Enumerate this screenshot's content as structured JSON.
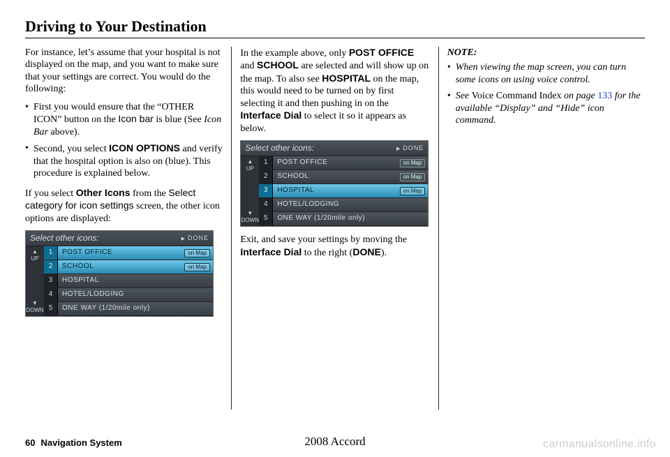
{
  "page": {
    "title": "Driving to Your Destination",
    "number": "60",
    "system_label": "Navigation System",
    "model": "2008  Accord",
    "watermark": "carmanualsonline.info"
  },
  "col1": {
    "p1": "For instance, let’s assume that your hospital is not displayed on the map, and you want to make sure that your settings are correct. You would do the following:",
    "b1_pre": "First you would ensure that the “OTHER ICON” button on the ",
    "b1_icon_bar": "Icon bar",
    "b1_mid": " is blue (See ",
    "b1_iconbar_ref": "Icon Bar",
    "b1_end": " above).",
    "b2_pre": "Second, you select ",
    "b2_opt": "ICON OPTIONS",
    "b2_end": " and verify that the hospital option is also on (blue). This procedure is explained below.",
    "p2_pre": "If you select ",
    "p2_other": "Other Icons",
    "p2_mid": " from the ",
    "p2_sel": "Select category for icon settings",
    "p2_end": " screen, the other icon options are displayed:"
  },
  "nav1": {
    "title": "Select other icons:",
    "done": "DONE",
    "up": "UP",
    "down": "DOWN",
    "rows": [
      {
        "n": "1",
        "label": "POST OFFICE",
        "tag": "on Map",
        "sel": true
      },
      {
        "n": "2",
        "label": "SCHOOL",
        "tag": "on Map",
        "sel": true
      },
      {
        "n": "3",
        "label": "HOSPITAL",
        "tag": "",
        "sel": false
      },
      {
        "n": "4",
        "label": "HOTEL/LODGING",
        "tag": "",
        "sel": false
      },
      {
        "n": "5",
        "label": "ONE WAY (1/20mile only)",
        "tag": "",
        "sel": false
      }
    ]
  },
  "col2": {
    "p1_pre": "In the example above, only ",
    "p1_po": "POST OFFICE",
    "p1_and": " and ",
    "p1_sc": "SCHOOL",
    "p1_mid": " are selected and will show up on the map. To also see ",
    "p1_hos": "HOSPITAL",
    "p1_mid2": " on the map, this would need to be turned on by first selecting it and then pushing in on the ",
    "p1_dial": "Interface Dial",
    "p1_end": " to select it so it appears as below.",
    "p2_pre": "Exit, and save your settings by moving the ",
    "p2_dial": "Interface Dial",
    "p2_mid": " to the right (",
    "p2_done": "DONE",
    "p2_end": ")."
  },
  "nav2": {
    "title": "Select other icons:",
    "done": "DONE",
    "up": "UP",
    "down": "DOWN",
    "rows": [
      {
        "n": "1",
        "label": "POST OFFICE",
        "tag": "on Map",
        "sel": false
      },
      {
        "n": "2",
        "label": "SCHOOL",
        "tag": "on Map",
        "sel": false
      },
      {
        "n": "3",
        "label": "HOSPITAL",
        "tag": "on Map",
        "sel": true
      },
      {
        "n": "4",
        "label": "HOTEL/LODGING",
        "tag": "",
        "sel": false
      },
      {
        "n": "5",
        "label": "ONE WAY (1/20mile only)",
        "tag": "",
        "sel": false
      }
    ]
  },
  "col3": {
    "note": "NOTE:",
    "b1": "When viewing the map screen, you can turn some icons on using voice control.",
    "b2_pre": "See ",
    "b2_vci": "Voice Command Index",
    "b2_mid": " on page ",
    "b2_page": "133",
    "b2_end": " for the available “Display” and “Hide” icon command."
  }
}
